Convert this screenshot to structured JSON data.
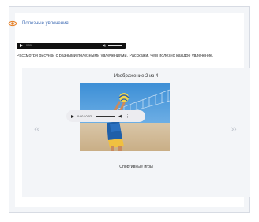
{
  "header": {
    "title": "Полезные увлечения",
    "icon": "eye-icon",
    "accent": "#e67e22"
  },
  "main_audio": {
    "time": "0:00",
    "icon": "speaker-icon"
  },
  "instruction": "Рассмотри рисунки с разными полезными увлечениями. Расскажи, чем полезно каждое увлечение.",
  "gallery": {
    "counter": "Изображение 2 из 4",
    "caption": "Спортивные игры",
    "prev_icon": "chevron-left-icon",
    "next_icon": "chevron-right-icon"
  },
  "pill_audio": {
    "time": "0:00 / 0:02"
  }
}
